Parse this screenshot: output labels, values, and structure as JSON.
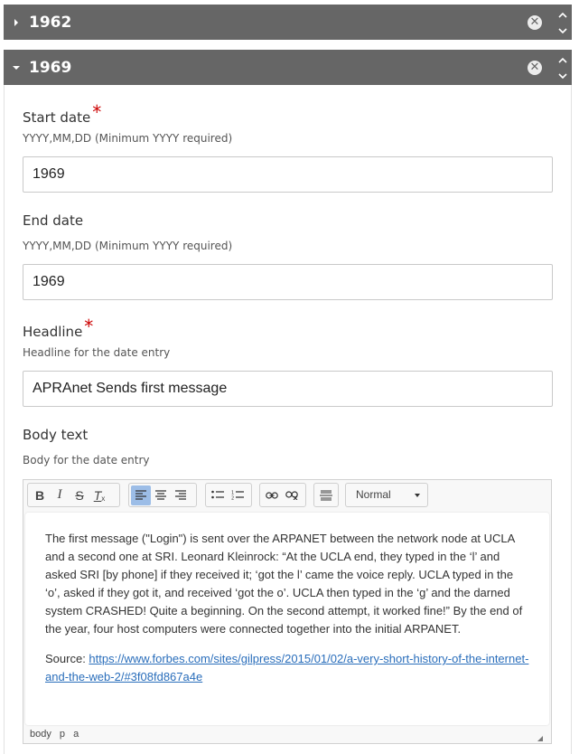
{
  "entries": {
    "collapsed": {
      "year": "1962"
    },
    "expanded": {
      "year": "1969"
    }
  },
  "form": {
    "start_date": {
      "label": "Start date",
      "required_mark": "*",
      "hint": "YYYY,MM,DD (Minimum YYYY required)",
      "value": "1969"
    },
    "end_date": {
      "label": "End date",
      "hint": "YYYY,MM,DD (Minimum YYYY required)",
      "value": "1969"
    },
    "headline": {
      "label": "Headline",
      "required_mark": "*",
      "hint": "Headline for the date entry",
      "value": "APRAnet Sends first message"
    },
    "body_text": {
      "label": "Body text",
      "hint": "Body for the date entry"
    }
  },
  "editor": {
    "toolbar": {
      "bold": "B",
      "italic": "I",
      "strike": "S",
      "clear_format": "T",
      "format_select": "Normal"
    },
    "paragraph1": "The first message (\"Login\") is sent over the ARPANET between the network node at UCLA and a second one at SRI. Leonard Kleinrock: “At the UCLA end, they typed in the ‘l’ and asked SRI [by phone] if they received it; ‘got the l’ came the voice reply. UCLA typed in the ‘o’, asked if they got it, and received ‘got the o’. UCLA then typed in the ‘g’ and the darned system CRASHED! Quite a beginning. On the second attempt, it worked fine!” By the end of the year, four host computers were connected together into the initial ARPANET.",
    "source_label": "Source: ",
    "source_link": "https://www.forbes.com/sites/gilpress/2015/01/02/a-very-short-history-of-the-internet-and-the-web-2/#3f08fd867a4e",
    "status_path": [
      "body",
      "p",
      "a"
    ]
  },
  "colors": {
    "header_bg": "#666666",
    "required": "#cc0000",
    "link": "#2a6ebb",
    "active_button": "#9cbde7"
  }
}
